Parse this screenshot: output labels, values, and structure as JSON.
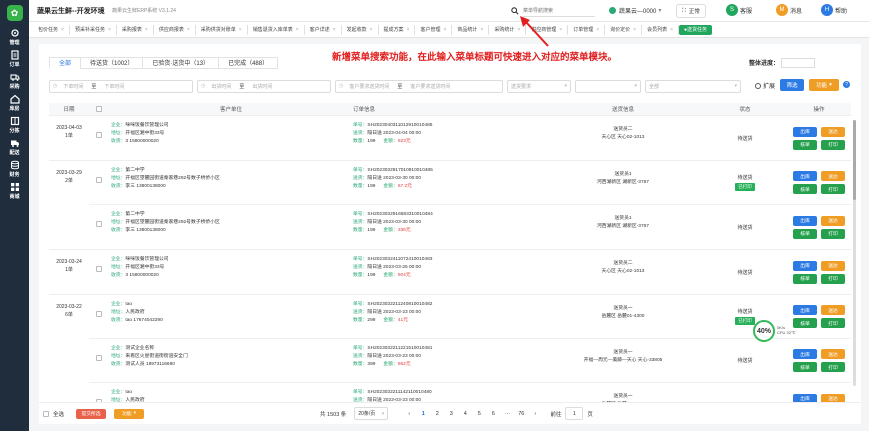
{
  "sidebar": {
    "logo_glyph": "✿",
    "items": [
      {
        "label": "管理",
        "icon": "gear-icon"
      },
      {
        "label": "订单",
        "icon": "document-icon"
      },
      {
        "label": "采购",
        "icon": "truck-icon"
      },
      {
        "label": "库房",
        "icon": "house-icon"
      },
      {
        "label": "分拣",
        "icon": "sort-icon"
      },
      {
        "label": "配送",
        "icon": "delivery-icon"
      },
      {
        "label": "财务",
        "icon": "database-icon"
      },
      {
        "label": "商城",
        "icon": "grid-icon"
      }
    ]
  },
  "topbar": {
    "brand": "蔬果云生鲜--开发环境",
    "version": "蔬果云生鲜ERP系统 V3.1.24",
    "search_placeholder": "菜单导航搜索",
    "user": "蔬果云---0000",
    "fullscreen_label": "正常",
    "service_label": "客服",
    "message_label": "消息",
    "help_label": "帮助",
    "icons": {
      "service": "S",
      "message": "M",
      "help": "H"
    },
    "colors": {
      "service": "#21a65e",
      "message": "#f09d26",
      "help": "#2c7be5"
    }
  },
  "page_tabs": [
    "包价任务",
    "预采补采任务",
    "采购报表",
    "供应商报表",
    "采购供货对账单",
    "销售退货入库单表",
    "客户详述",
    "发起收款",
    "提成方案",
    "客户管理",
    "商品统计",
    "采购统计",
    "供应商管理",
    "订单管理",
    "询价定价",
    "会员列表",
    "●送货任务"
  ],
  "annotation": "新增菜单搜索功能，在此输入菜单标题可快速进入对应的菜单模块。",
  "status_tabs": [
    "全部",
    "待送货（1002）",
    "已验货·送货中（13）",
    "已完成（488）"
  ],
  "width_setting_label": "整体进度：",
  "filters": {
    "start_time": "下单时间",
    "to1": "至",
    "end_time": "下单时间",
    "start_ship": "出货时间",
    "to2": "至",
    "end_ship": "出货时间",
    "start_customer": "客户要求送货时间",
    "to3": "至",
    "end_customer": "客户要求送货时间",
    "select1": "送货要求",
    "select2": "",
    "select3": "全部",
    "expand_label": "扩展",
    "filter_button": "筛选",
    "function_button": "功能",
    "help_glyph": "?"
  },
  "table": {
    "headers": [
      "日期",
      "",
      "客户单位",
      "订单信息",
      "送货信息",
      "状态",
      "操作"
    ],
    "groups": [
      {
        "date": "2023-04-03",
        "count": "1单",
        "orders": [
          {
            "company": "企业：",
            "company_v": "咪咪饭餐饮管理公司",
            "addr": "地址：",
            "addr_v": "开福区湘中街33号",
            "contact": "收货：",
            "contact_v": "3 15800000020",
            "no": "单号：",
            "no_v": "SH2023040311012910010485",
            "ship": "送货：",
            "ship_v": "隔日送 2023-04-04 00:00",
            "qty": "数量：",
            "qty_v": "199",
            "amt": "金额：",
            "amt_v": "923元",
            "deliv1": "送货员二",
            "deliv2": "天心区 天心02-1013",
            "status": "待送货",
            "tag": "",
            "btns": [
              "出库",
              "送达",
              "核单",
              "打印"
            ]
          }
        ]
      },
      {
        "date": "2023-03-29",
        "count": "2单",
        "orders": [
          {
            "company": "企业：",
            "company_v": "第二中学",
            "addr": "地址：",
            "addr_v": "开福区望麓园街道秦家巷292号数子桥侨小区",
            "contact": "收货：",
            "contact_v": "李三 13800138000",
            "no": "单号：",
            "no_v": "SH2023032917010910010485",
            "ship": "送货：",
            "ship_v": "隔日送 2023-03-30 00:00",
            "qty": "数量：",
            "qty_v": "199",
            "amt": "金额：",
            "amt_v": "67.2元",
            "deliv1": "送货员1",
            "deliv2": "河西湖新区 湖新区-3767",
            "status": "待送货",
            "tag": "已打印",
            "btns": [
              "出库",
              "送达",
              "核单",
              "打印"
            ]
          },
          {
            "company": "企业：",
            "company_v": "第二中学",
            "addr": "地址：",
            "addr_v": "开福区望麓园街道秦家巷292号数子桥侨小区",
            "contact": "收货：",
            "contact_v": "李三 13800138000",
            "no": "单号：",
            "no_v": "SH2023032916583310010484",
            "ship": "送货：",
            "ship_v": "隔日送 2023-03-30 00:00",
            "qty": "数量：",
            "qty_v": "199",
            "amt": "金额：",
            "amt_v": "336元",
            "deliv1": "送货员1",
            "deliv2": "河西湖新区 湖新区-3767",
            "status": "待送货",
            "tag": "",
            "btns": [
              "出库",
              "送达",
              "核单",
              "打印"
            ]
          }
        ]
      },
      {
        "date": "2023-03-24",
        "count": "1单",
        "orders": [
          {
            "company": "企业：",
            "company_v": "咪咪饭餐饮管理公司",
            "addr": "地址：",
            "addr_v": "开福区湘中街33号",
            "contact": "收货：",
            "contact_v": "3 15800000020",
            "no": "单号：",
            "no_v": "SH2023032411072410010483",
            "ship": "送货：",
            "ship_v": "隔日送 2023-03-25 00:00",
            "qty": "数量：",
            "qty_v": "199",
            "amt": "金额：",
            "amt_v": "504元",
            "deliv1": "送货员二",
            "deliv2": "天心区 天心02-1013",
            "status": "待送货",
            "tag": "",
            "btns": [
              "出库",
              "送达",
              "核单",
              "打印"
            ]
          }
        ]
      },
      {
        "date": "2023-03-22",
        "count": "6单",
        "orders": [
          {
            "company": "企业：",
            "company_v": "tao",
            "addr": "地址：",
            "addr_v": "人民政府",
            "contact": "收货：",
            "contact_v": "tao 17674042290",
            "no": "单号：",
            "no_v": "SH2023032211240810010482",
            "ship": "送货：",
            "ship_v": "隔日送 2023-03-23 00:00",
            "qty": "数量：",
            "qty_v": "299",
            "amt": "金额：",
            "amt_v": "41元",
            "deliv1": "送货员一",
            "deliv2": "岳麓区 岳麓01-4300",
            "status": "待送货",
            "tag": "已打印",
            "btns": [
              "出库",
              "送达",
              "核单",
              "打印"
            ]
          },
          {
            "company": "企业：",
            "company_v": "测试企业名称",
            "addr": "地址：",
            "addr_v": "来看区火星街道街街道安全门",
            "contact": "收货：",
            "contact_v": "测试人员 18973116690",
            "no": "单号：",
            "no_v": "SH2023032211221510010481",
            "ship": "送货：",
            "ship_v": "隔日送 2023-03-23 00:00",
            "qty": "数量：",
            "qty_v": "399",
            "amt": "金额：",
            "amt_v": "862元",
            "deliv1": "送货员一",
            "deliv2": "开福—周元—美藤—天心 天心-33805",
            "status": "待送货",
            "tag": "",
            "btns": [
              "出库",
              "送达",
              "核单",
              "打印"
            ]
          },
          {
            "company": "企业：",
            "company_v": "tao",
            "addr": "地址：",
            "addr_v": "人民政府",
            "contact": "收货：",
            "contact_v": "",
            "no": "单号：",
            "no_v": "SH2023032211142110010480",
            "ship": "送货：",
            "ship_v": "隔日送 2023-03-23 00:00",
            "qty": "",
            "qty_v": "",
            "amt": "",
            "amt_v": "",
            "deliv1": "送货员一",
            "deliv2": "岳麓区 岳麓01-4300",
            "status": "待送货",
            "tag": "",
            "btns": [
              "出库",
              "送达",
              "核单",
              "打印"
            ]
          }
        ]
      }
    ]
  },
  "footer": {
    "select_all": "全选",
    "batch_button": "提交所选",
    "function_button": "功能",
    "total": "共 1503 条",
    "page_size": "20条/页",
    "pages": [
      "‹",
      "1",
      "2",
      "3",
      "4",
      "5",
      "6",
      "···",
      "76",
      "›"
    ],
    "current_page": "1",
    "goto_label": "前往",
    "goto_value": "1",
    "page_unit": "页"
  },
  "perf_widget": {
    "percent": "40%",
    "line1": "0K/s",
    "line2": "CPU 32℃"
  }
}
